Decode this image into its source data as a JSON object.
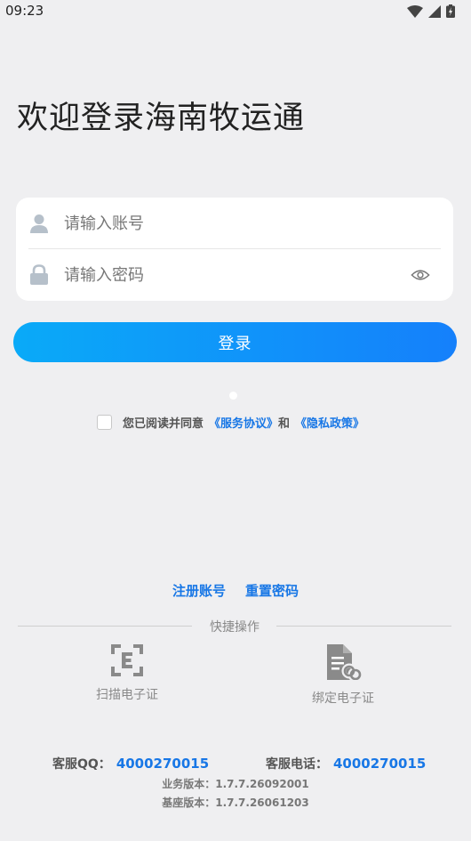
{
  "status_bar": {
    "time": "09:23"
  },
  "title": "欢迎登录海南牧运通",
  "form": {
    "account_placeholder": "请输入账号",
    "password_placeholder": "请输入密码"
  },
  "login_button": "登录",
  "agreement": {
    "prefix": "您已阅读并同意",
    "service": "《服务协议》",
    "and": "和",
    "privacy": "《隐私政策》"
  },
  "links": {
    "register": "注册账号",
    "reset": "重置密码"
  },
  "quick_ops": {
    "label": "快捷操作",
    "scan": "扫描电子证",
    "bind": "绑定电子证"
  },
  "contact": {
    "qq_label": "客服QQ：",
    "qq_value": "4000270015",
    "tel_label": "客服电话：",
    "tel_value": "4000270015"
  },
  "versions": {
    "business": "业务版本：1.7.7.26092001",
    "base": "基座版本：1.7.7.26061203"
  },
  "colors": {
    "accent": "#1877e6",
    "button_start": "#0aaaf8",
    "button_end": "#1580fb"
  }
}
